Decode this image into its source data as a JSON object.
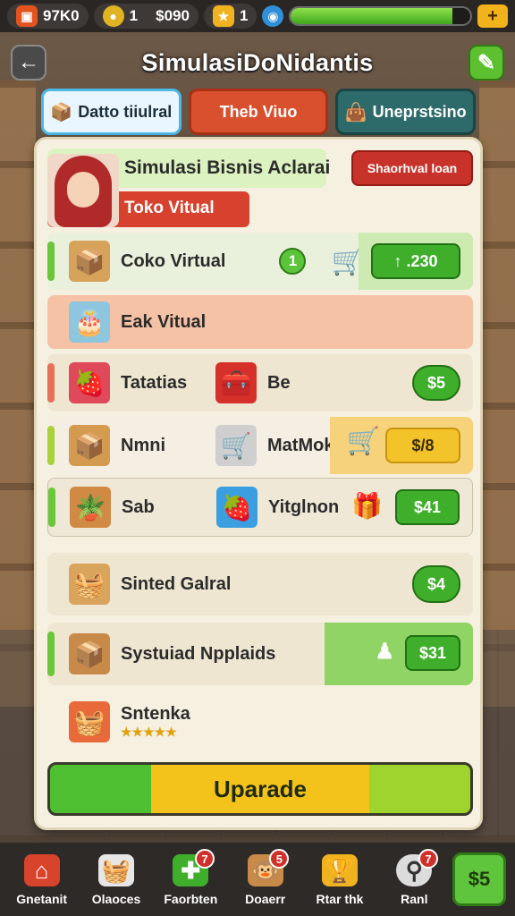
{
  "topbar": {
    "coins_value": "97K0",
    "gems_count": "1",
    "money": "$090",
    "stars_count": "1",
    "xp_progress": 0.9,
    "plus_label": "+"
  },
  "header": {
    "title": "SimulasiDoNidantis",
    "back_icon": "back-arrow-icon",
    "edit_icon": "pencil-icon"
  },
  "tabs": [
    {
      "label": "Datto tiiulral",
      "icon": "box-icon"
    },
    {
      "label": "Theb Viuo",
      "icon": ""
    },
    {
      "label": "Uneprstsino",
      "icon": "bag-icon"
    }
  ],
  "panel": {
    "title": "Simulasi Bisnis Aclarai",
    "subtitle": "Toko Vitual",
    "action_button": "Shaorhval loan"
  },
  "items": [
    {
      "name": "Coko Virtual",
      "count": "1",
      "price": "↑ .230"
    },
    {
      "name": "Eak Vitual"
    },
    {
      "name": "Tatatias",
      "name2": "Be",
      "price": "$5"
    },
    {
      "name": "Nmni",
      "name2": "MatMok",
      "price": "$/8"
    },
    {
      "name": "Sab",
      "name2": "Yitglnon",
      "price": "$41"
    },
    {
      "name": "Sinted Galral",
      "price": "$4"
    },
    {
      "name": "Systuiad Npplaids",
      "price": "$31"
    },
    {
      "name": "Sntenka",
      "stars": "★★★★★"
    }
  ],
  "upgrade_label": "Uparade",
  "bottom_nav": [
    {
      "label": "Gnetanit",
      "icon": "shop-icon",
      "badge": ""
    },
    {
      "label": "Olaoces",
      "icon": "basket-icon",
      "badge": ""
    },
    {
      "label": "Faorbten",
      "icon": "gift-icon",
      "badge": "7"
    },
    {
      "label": "Doaerr",
      "icon": "monkey-icon",
      "badge": "5"
    },
    {
      "label": "Rtar thk",
      "icon": "trophy-icon",
      "badge": ""
    },
    {
      "label": "Ranl",
      "icon": "search-icon",
      "badge": "7"
    }
  ],
  "cash_button": "$5",
  "colors": {
    "accent_green": "#3fae2a",
    "accent_red": "#d6422e",
    "accent_gold": "#f2c42a",
    "panel_bg": "#f6f0e1"
  }
}
